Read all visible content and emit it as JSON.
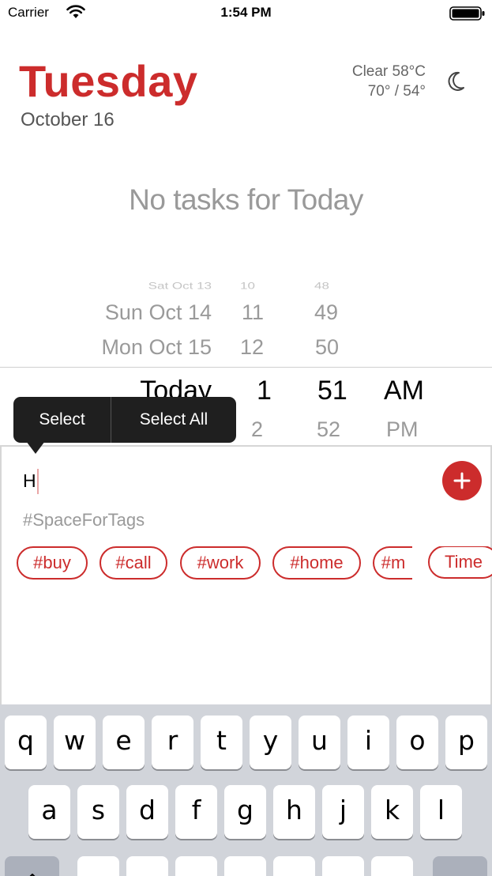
{
  "status_bar": {
    "carrier": "Carrier",
    "time": "1:54 PM"
  },
  "header": {
    "day": "Tuesday",
    "date": "October 16",
    "weather_line1": "Clear 58°C",
    "weather_line2": "70° / 54°"
  },
  "empty_message": "No tasks for Today",
  "picker": {
    "dates": [
      "Sat Oct 13",
      "Sun Oct 14",
      "Mon Oct 15",
      "Today"
    ],
    "hours": [
      "10",
      "11",
      "12",
      "1",
      "2"
    ],
    "minutes": [
      "48",
      "49",
      "50",
      "51",
      "52"
    ],
    "ampm": [
      "AM",
      "PM"
    ]
  },
  "edit_menu": {
    "select": "Select",
    "select_all": "Select All"
  },
  "input": {
    "value": "H",
    "tags_placeholder": "#SpaceForTags",
    "chips": [
      "#buy",
      "#call",
      "#work",
      "#home",
      "#m",
      "Time"
    ]
  },
  "keyboard": {
    "row1": [
      "q",
      "w",
      "e",
      "r",
      "t",
      "y",
      "u",
      "i",
      "o",
      "p"
    ],
    "row2": [
      "a",
      "s",
      "d",
      "f",
      "g",
      "h",
      "j",
      "k",
      "l"
    ]
  },
  "colors": {
    "accent": "#cc2c2c",
    "keyboard_bg": "#d1d4da"
  }
}
